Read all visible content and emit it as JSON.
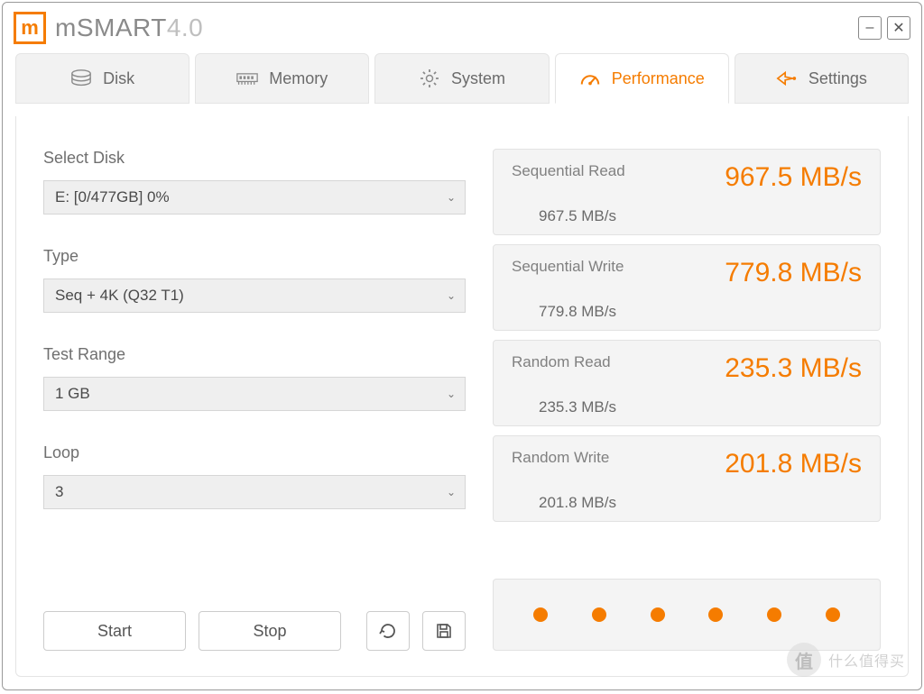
{
  "app": {
    "name": "mSMART",
    "version": "4.0"
  },
  "tabs": {
    "disk": "Disk",
    "memory": "Memory",
    "system": "System",
    "performance": "Performance",
    "settings": "Settings",
    "active": "performance"
  },
  "form": {
    "select_disk_label": "Select Disk",
    "select_disk_value": "E: [0/477GB] 0%",
    "type_label": "Type",
    "type_value": "Seq + 4K (Q32 T1)",
    "test_range_label": "Test Range",
    "test_range_value": "1 GB",
    "loop_label": "Loop",
    "loop_value": "3"
  },
  "buttons": {
    "start": "Start",
    "stop": "Stop"
  },
  "results": [
    {
      "label": "Sequential Read",
      "value": "967.5 MB/s",
      "sub": "967.5 MB/s"
    },
    {
      "label": "Sequential Write",
      "value": "779.8 MB/s",
      "sub": "779.8 MB/s"
    },
    {
      "label": "Random Read",
      "value": "235.3 MB/s",
      "sub": "235.3 MB/s"
    },
    {
      "label": "Random Write",
      "value": "201.8 MB/s",
      "sub": "201.8 MB/s"
    }
  ],
  "watermark": "什么值得买",
  "colors": {
    "accent": "#f57c00"
  }
}
